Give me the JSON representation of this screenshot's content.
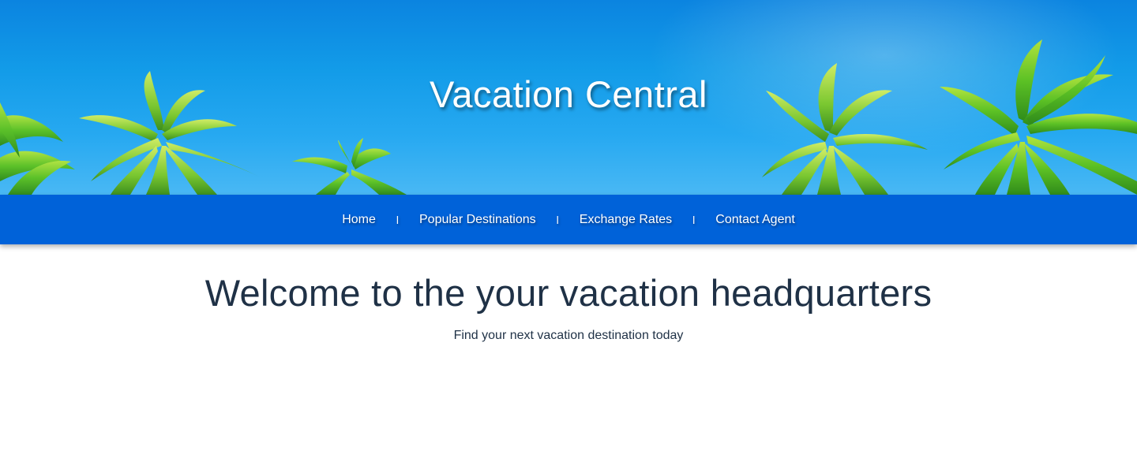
{
  "header": {
    "title": "Vacation Central"
  },
  "nav": {
    "items": [
      {
        "label": "Home",
        "icon": ""
      },
      {
        "label": "Popular Destinations"
      },
      {
        "label": "Exchange Rates"
      },
      {
        "label": "Contact Agent"
      }
    ],
    "separator": "l"
  },
  "main": {
    "heading": "Welcome to the your vacation headquarters",
    "subheading": "Find your next vacation destination today"
  },
  "colors": {
    "nav_background": "#0062d9",
    "sky": "#129be8",
    "text_dark": "#1f3146"
  },
  "icons": {
    "hero_image": "palm-trees-sky-image"
  }
}
